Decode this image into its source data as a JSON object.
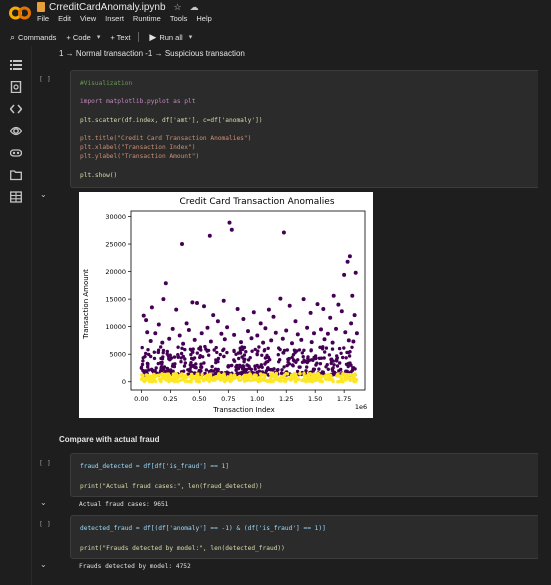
{
  "header": {
    "file_name": "CrreditCardAnomaly.ipynb",
    "menu": [
      "File",
      "Edit",
      "View",
      "Insert",
      "Runtime",
      "Tools",
      "Help"
    ]
  },
  "toolbar": {
    "commands": "Commands",
    "code": "+ Code",
    "text": "+ Text",
    "run_all": "Run all"
  },
  "notebook": {
    "top_markdown": "1 → Normal transaction -1 → Suspicious transaction",
    "cell1": {
      "bracket": "[ ]",
      "lines": [
        "#Visualization",
        "import matplotlib.pyplot as plt",
        "plt.scatter(df.index, df['amt'], c=df['anomaly'])",
        "plt.title(\"Credit Card Transaction Anomalies\")",
        "plt.xlabel(\"Transaction Index\")",
        "plt.ylabel(\"Transaction Amount\")",
        "plt.show()"
      ]
    },
    "heading": "Compare with actual fraud",
    "cell2": {
      "bracket": "[ ]",
      "lines": [
        "fraud_detected = df[df['is_fraud'] == 1]",
        "print(\"Actual fraud cases:\", len(fraud_detected))"
      ],
      "output": "Actual fraud cases: 9651"
    },
    "cell3": {
      "bracket": "[ ]",
      "lines": [
        "detected_fraud = df[(df['anomaly'] == -1) & (df['is_fraud'] == 1)]",
        "print(\"Frauds detected by model:\", len(detected_fraud))"
      ],
      "output": "Frauds detected by model: 4752"
    }
  },
  "colors": {
    "anomaly": "#440154",
    "normal": "#fde725",
    "background": "#1e1e1e"
  },
  "chart_data": {
    "type": "scatter",
    "title": "Credit Card Transaction Anomalies",
    "xlabel": "Transaction Index",
    "ylabel": "Transaction Amount",
    "x_offset_label": "1e6",
    "xlim": [
      -0.09,
      1.93
    ],
    "ylim": [
      -1500,
      31000
    ],
    "xticks": [
      "0.00",
      "0.25",
      "0.50",
      "0.75",
      "1.00",
      "1.25",
      "1.50",
      "1.75"
    ],
    "yticks": [
      "0",
      "5000",
      "10000",
      "15000",
      "20000",
      "25000",
      "30000"
    ],
    "series": [
      {
        "name": "-1",
        "color": "#440154",
        "points": [
          [
            0.35,
            25000
          ],
          [
            0.59,
            26500
          ],
          [
            0.76,
            28900
          ],
          [
            0.78,
            27600
          ],
          [
            1.23,
            27100
          ],
          [
            1.8,
            22800
          ],
          [
            1.78,
            21800
          ],
          [
            1.75,
            19400
          ],
          [
            1.85,
            19800
          ],
          [
            1.7,
            14000
          ],
          [
            0.21,
            17900
          ],
          [
            0.19,
            15000
          ],
          [
            0.02,
            12000
          ],
          [
            0.04,
            11200
          ],
          [
            0.09,
            13500
          ],
          [
            0.15,
            10400
          ],
          [
            0.3,
            13100
          ],
          [
            0.39,
            10600
          ],
          [
            0.44,
            14400
          ],
          [
            0.48,
            14300
          ],
          [
            0.54,
            13700
          ],
          [
            0.62,
            12100
          ],
          [
            0.66,
            11000
          ],
          [
            0.71,
            14700
          ],
          [
            0.83,
            13200
          ],
          [
            0.88,
            11400
          ],
          [
            0.97,
            12600
          ],
          [
            1.03,
            10600
          ],
          [
            1.1,
            13100
          ],
          [
            1.14,
            11800
          ],
          [
            1.2,
            15100
          ],
          [
            1.28,
            13800
          ],
          [
            1.33,
            11000
          ],
          [
            1.4,
            15000
          ],
          [
            1.46,
            12500
          ],
          [
            1.52,
            14100
          ],
          [
            1.57,
            13200
          ],
          [
            1.63,
            11600
          ],
          [
            1.66,
            15600
          ],
          [
            1.73,
            12800
          ],
          [
            1.81,
            10600
          ],
          [
            1.84,
            12100
          ],
          [
            1.82,
            15600
          ],
          [
            0.05,
            9000
          ],
          [
            0.12,
            8800
          ],
          [
            0.27,
            9600
          ],
          [
            0.33,
            8400
          ],
          [
            0.41,
            9400
          ],
          [
            0.52,
            8800
          ],
          [
            0.57,
            9800
          ],
          [
            0.69,
            8700
          ],
          [
            0.74,
            9900
          ],
          [
            0.8,
            8500
          ],
          [
            0.92,
            9200
          ],
          [
            1.0,
            8400
          ],
          [
            1.07,
            9700
          ],
          [
            1.16,
            8900
          ],
          [
            1.25,
            9300
          ],
          [
            1.35,
            8600
          ],
          [
            1.43,
            9800
          ],
          [
            1.49,
            8800
          ],
          [
            1.55,
            9500
          ],
          [
            1.61,
            8700
          ],
          [
            1.68,
            9600
          ],
          [
            1.76,
            9000
          ],
          [
            1.86,
            8800
          ],
          [
            0.08,
            7400
          ],
          [
            0.18,
            7100
          ],
          [
            0.24,
            7800
          ],
          [
            0.36,
            6900
          ],
          [
            0.46,
            7600
          ],
          [
            0.6,
            7300
          ],
          [
            0.72,
            7700
          ],
          [
            0.86,
            7200
          ],
          [
            0.95,
            7900
          ],
          [
            1.05,
            7100
          ],
          [
            1.12,
            7500
          ],
          [
            1.22,
            7800
          ],
          [
            1.3,
            7000
          ],
          [
            1.38,
            7600
          ],
          [
            1.47,
            7200
          ],
          [
            1.58,
            7700
          ],
          [
            1.65,
            7100
          ],
          [
            1.79,
            7500
          ],
          [
            1.83,
            7300
          ]
        ]
      },
      {
        "name": "1",
        "color": "#fde725",
        "band": [
          0,
          1500
        ]
      }
    ],
    "grid": false
  }
}
